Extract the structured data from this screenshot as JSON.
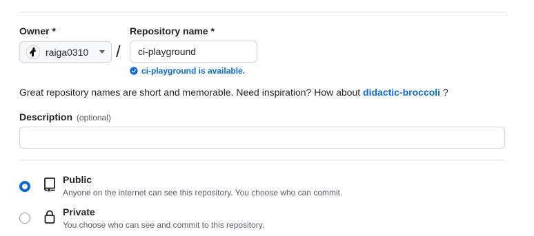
{
  "owner": {
    "label": "Owner *",
    "selected": "raiga0310"
  },
  "repository": {
    "label": "Repository name *",
    "value": "ci-playground",
    "availability": "ci-playground is available."
  },
  "separator": "/",
  "hint": {
    "text": "Great repository names are short and memorable. Need inspiration? How about",
    "suggestion": "didactic-broccoli",
    "suffix": "?"
  },
  "description": {
    "label": "Description",
    "optional": "(optional)",
    "value": "",
    "placeholder": ""
  },
  "visibility": {
    "options": [
      {
        "title": "Public",
        "description": "Anyone on the internet can see this repository. You choose who can commit.",
        "checked": true,
        "icon": "repo-icon"
      },
      {
        "title": "Private",
        "description": "You choose who can see and commit to this repository.",
        "checked": false,
        "icon": "lock-icon"
      }
    ]
  },
  "colors": {
    "accent": "#0969da",
    "border": "#d0d7de",
    "text": "#1f2328",
    "muted": "#57606a"
  }
}
